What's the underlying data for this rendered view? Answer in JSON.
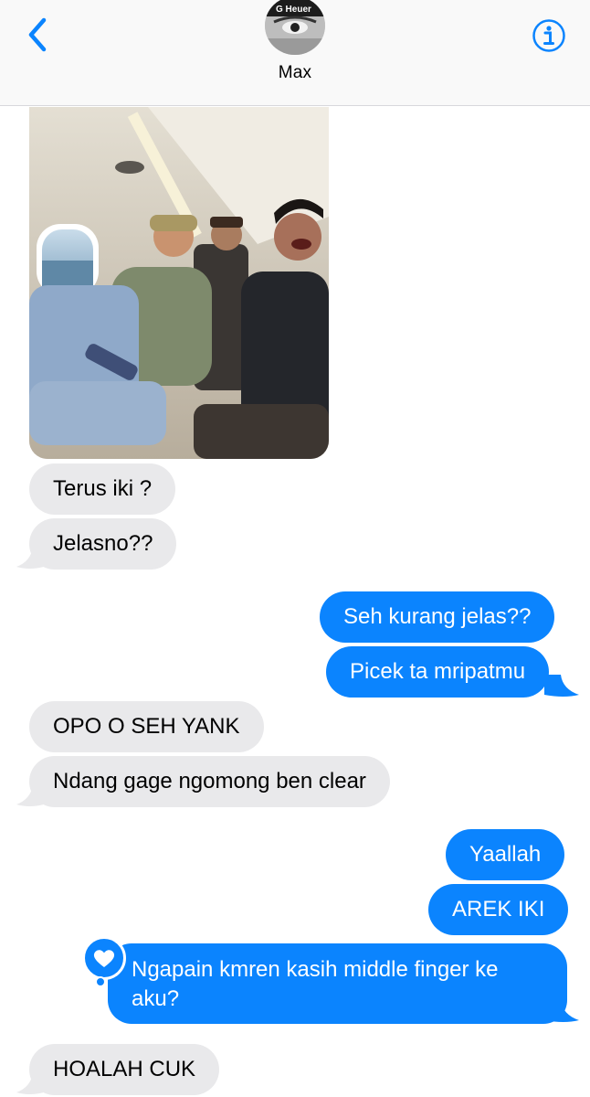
{
  "header": {
    "contact_name": "Max",
    "avatar_text": "G Heuer"
  },
  "messages": [
    {
      "from": "them",
      "text": "Terus iki ?"
    },
    {
      "from": "them",
      "text": "Jelasno??"
    },
    {
      "from": "me",
      "text": "Seh kurang jelas??"
    },
    {
      "from": "me",
      "text": "Picek ta mripatmu"
    },
    {
      "from": "them",
      "text": "OPO O SEH YANK"
    },
    {
      "from": "them",
      "text": "Ndang gage ngomong ben clear"
    },
    {
      "from": "me",
      "text": "Yaallah"
    },
    {
      "from": "me",
      "text": "AREK IKI"
    },
    {
      "from": "me",
      "text": "Ngapain kmren kasih middle finger ke aku?",
      "reaction": "heart"
    },
    {
      "from": "them",
      "text": "HOALAH CUK"
    }
  ],
  "colors": {
    "accent": "#0b84fe",
    "incoming_bubble": "#e9e9eb",
    "header_bg": "#f9f9f9"
  }
}
